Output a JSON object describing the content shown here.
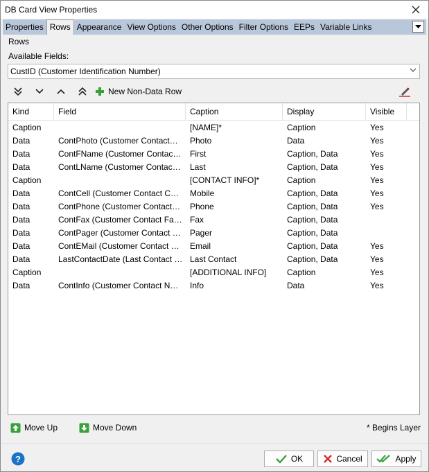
{
  "window": {
    "title": "DB Card View Properties"
  },
  "tabs": [
    {
      "label": "Properties"
    },
    {
      "label": "Rows"
    },
    {
      "label": "Appearance"
    },
    {
      "label": "View Options"
    },
    {
      "label": "Other Options"
    },
    {
      "label": "Filter Options"
    },
    {
      "label": "EEPs"
    },
    {
      "label": "Variable Links"
    }
  ],
  "active_tab": "Rows",
  "group_label": "Rows",
  "available_fields": {
    "label": "Available Fields:",
    "value": "CustID  (Customer Identification Number)"
  },
  "toolbar": {
    "new_row_label": "New Non-Data Row"
  },
  "grid": {
    "columns": [
      "Kind",
      "Field",
      "Caption",
      "Display",
      "Visible"
    ],
    "rows": [
      {
        "kind": "Caption",
        "field": "",
        "caption": "[NAME]*",
        "display": "Caption",
        "visible": "Yes"
      },
      {
        "kind": "Data",
        "field": "ContPhoto  (Customer Contact…",
        "caption": "Photo",
        "display": "Data",
        "visible": "Yes"
      },
      {
        "kind": "Data",
        "field": "ContFName  (Customer Contac…",
        "caption": "First",
        "display": "Caption, Data",
        "visible": "Yes"
      },
      {
        "kind": "Data",
        "field": "ContLName  (Customer Contac…",
        "caption": "Last",
        "display": "Caption, Data",
        "visible": "Yes"
      },
      {
        "kind": "Caption",
        "field": "",
        "caption": "[CONTACT INFO]*",
        "display": "Caption",
        "visible": "Yes"
      },
      {
        "kind": "Data",
        "field": "ContCell  (Customer Contact C…",
        "caption": "Mobile",
        "display": "Caption, Data",
        "visible": "Yes"
      },
      {
        "kind": "Data",
        "field": "ContPhone  (Customer Contact…",
        "caption": "Phone",
        "display": "Caption, Data",
        "visible": "Yes"
      },
      {
        "kind": "Data",
        "field": "ContFax  (Customer Contact Fa…",
        "caption": "Fax",
        "display": "Caption, Data",
        "visible": ""
      },
      {
        "kind": "Data",
        "field": "ContPager  (Customer Contact …",
        "caption": "Pager",
        "display": "Caption, Data",
        "visible": ""
      },
      {
        "kind": "Data",
        "field": "ContEMail  (Customer Contact …",
        "caption": "Email",
        "display": "Caption, Data",
        "visible": "Yes"
      },
      {
        "kind": "Data",
        "field": "LastContactDate  (Last Contact …",
        "caption": "Last Contact",
        "display": "Caption, Data",
        "visible": "Yes"
      },
      {
        "kind": "Caption",
        "field": "",
        "caption": "[ADDITIONAL INFO]",
        "display": "Caption",
        "visible": "Yes"
      },
      {
        "kind": "Data",
        "field": "ContInfo  (Customer Contact N…",
        "caption": "Info",
        "display": "Data",
        "visible": "Yes"
      }
    ]
  },
  "bottom": {
    "move_up_label": "Move Up",
    "move_down_label": "Move Down",
    "begins_layer_note": "* Begins Layer"
  },
  "buttons": {
    "ok": "OK",
    "cancel": "Cancel",
    "apply": "Apply"
  },
  "colors": {
    "tabbar": "#b9c7db",
    "accent_green": "#3aa03a",
    "help_blue": "#1a73c7",
    "cancel_red": "#d22a2a"
  }
}
